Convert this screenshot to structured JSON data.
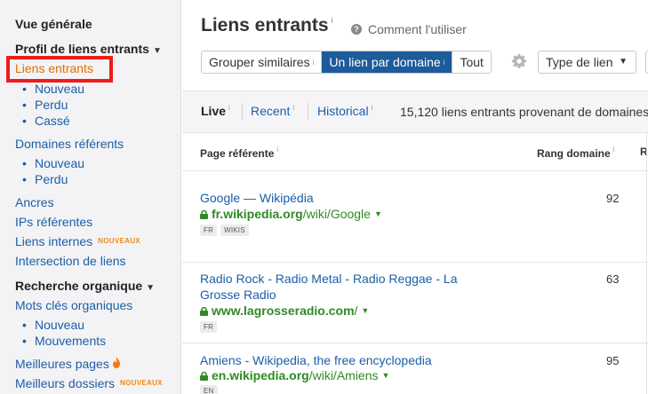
{
  "sidebar": {
    "overview": "Vue générale",
    "backlinks_profile": "Profil de liens entrants",
    "backlinks_active": "Liens entrants",
    "backlinks_sub": [
      "Nouveau",
      "Perdu",
      "Cassé"
    ],
    "referring_domains": "Domaines référents",
    "referring_domains_sub": [
      "Nouveau",
      "Perdu"
    ],
    "anchors": "Ancres",
    "referring_ips": "IPs référentes",
    "internal_links": "Liens internes",
    "new_badge": "NOUVEAUX",
    "link_intersect": "Intersection de liens",
    "organic_search": "Recherche organique",
    "organic_keywords": "Mots clés organiques",
    "organic_keywords_sub": [
      "Nouveau",
      "Mouvements"
    ],
    "top_pages": "Meilleures pages",
    "top_folders": "Meilleurs dossiers"
  },
  "header": {
    "title": "Liens entrants",
    "info": "i",
    "help": "Comment l'utiliser"
  },
  "toolbar": {
    "group_similar": "Grouper similaires",
    "one_per_domain": "Un lien par domaine",
    "all": "Tout",
    "link_type": "Type de lien",
    "info": "i"
  },
  "tabs": {
    "live": "Live",
    "recent": "Recent",
    "historical": "Historical",
    "info": "i",
    "summary": "15,120 liens entrants provenant de domaines"
  },
  "table": {
    "col_page": "Page référente",
    "col_dr": "Rang domaine",
    "col_next": "R",
    "info": "i",
    "rows": [
      {
        "title": "Google — Wikipédia",
        "domain": "fr.wikipedia.org",
        "path": "/wiki/Google",
        "tags": [
          "FR",
          "WIKIS"
        ],
        "dr": "92"
      },
      {
        "title": "Radio Rock - Radio Metal - Radio Reggae - La Grosse Radio",
        "domain": "www.lagrosseradio.com",
        "path": "/",
        "tags": [
          "FR"
        ],
        "dr": "63"
      },
      {
        "title": "Amiens - Wikipedia, the free encyclopedia",
        "domain": "en.wikipedia.org",
        "path": "/wiki/Amiens",
        "tags": [
          "EN"
        ],
        "dr": "95"
      }
    ]
  },
  "colors": {
    "accent": "#1d5b9b",
    "link": "#1c5ea8",
    "active": "#e66d00",
    "url_green": "#2f8a24",
    "highlight": "#ee1c1c"
  },
  "icons": [
    "help-icon",
    "gear-icon",
    "caret-down-icon",
    "lock-icon",
    "fire-icon"
  ]
}
